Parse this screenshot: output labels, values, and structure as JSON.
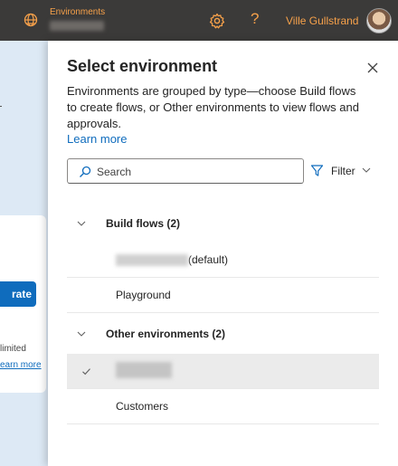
{
  "topbar": {
    "environment_label": "Environments",
    "help_symbol": "?",
    "user_name": "Ville Gullstrand",
    "icons": [
      "environment-icon",
      "gear-icon",
      "help-icon",
      "avatar"
    ],
    "accent_color": "#f7a14a",
    "background_color": "#3b3a39"
  },
  "background_page": {
    "button_label": "rate",
    "text_limited": "limited",
    "text_learn_more": "earn more"
  },
  "panel": {
    "title": "Select environment",
    "description": "Environments are grouped by type—choose Build flows to create flows, or Other environments to view flows and approvals.",
    "learn_more": "Learn more",
    "search": {
      "placeholder": "Search",
      "value": ""
    },
    "filter": {
      "label": "Filter"
    },
    "groups": [
      {
        "label": "Build flows (2)",
        "expanded": true,
        "items": [
          {
            "label": "(default)",
            "name_redacted": true,
            "selected": false
          },
          {
            "label": "Playground",
            "name_redacted": false,
            "selected": false
          }
        ]
      },
      {
        "label": "Other environments (2)",
        "expanded": true,
        "items": [
          {
            "label": "",
            "name_redacted": true,
            "selected": true
          },
          {
            "label": "Customers",
            "name_redacted": false,
            "selected": false
          }
        ]
      }
    ],
    "link_color": "#0f6cbd",
    "selected_row_color": "#ebebeb"
  }
}
